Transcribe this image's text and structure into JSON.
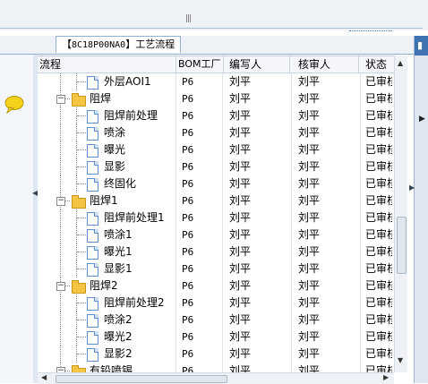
{
  "tab": {
    "prefix": "【",
    "code": "8C18P00NA0",
    "suffix": "】",
    "title": "工艺流程"
  },
  "columns": {
    "flow": "流程",
    "bom": "BOM工厂",
    "editor": "编写人",
    "reviewer": "核审人",
    "status": "状态"
  },
  "rows": [
    {
      "name": "外层AOI1",
      "level": 2,
      "type": "doc",
      "bom": "P6",
      "editor": "刘平",
      "reviewer": "刘平",
      "status": "已审核"
    },
    {
      "name": "阻焊",
      "level": 1,
      "type": "folder",
      "bom": "P6",
      "editor": "刘平",
      "reviewer": "刘平",
      "status": "已审核"
    },
    {
      "name": "阻焊前处理",
      "level": 2,
      "type": "doc",
      "bom": "P6",
      "editor": "刘平",
      "reviewer": "刘平",
      "status": "已审核"
    },
    {
      "name": "喷涂",
      "level": 2,
      "type": "doc",
      "bom": "P6",
      "editor": "刘平",
      "reviewer": "刘平",
      "status": "已审核"
    },
    {
      "name": "曝光",
      "level": 2,
      "type": "doc",
      "bom": "P6",
      "editor": "刘平",
      "reviewer": "刘平",
      "status": "已审核"
    },
    {
      "name": "显影",
      "level": 2,
      "type": "doc",
      "bom": "P6",
      "editor": "刘平",
      "reviewer": "刘平",
      "status": "已审核"
    },
    {
      "name": "终固化",
      "level": 2,
      "type": "doc",
      "bom": "P6",
      "editor": "刘平",
      "reviewer": "刘平",
      "status": "已审核"
    },
    {
      "name": "阻焊1",
      "level": 1,
      "type": "folder",
      "bom": "P6",
      "editor": "刘平",
      "reviewer": "刘平",
      "status": "已审核"
    },
    {
      "name": "阻焊前处理1",
      "level": 2,
      "type": "doc",
      "bom": "P6",
      "editor": "刘平",
      "reviewer": "刘平",
      "status": "已审核"
    },
    {
      "name": "喷涂1",
      "level": 2,
      "type": "doc",
      "bom": "P6",
      "editor": "刘平",
      "reviewer": "刘平",
      "status": "已审核"
    },
    {
      "name": "曝光1",
      "level": 2,
      "type": "doc",
      "bom": "P6",
      "editor": "刘平",
      "reviewer": "刘平",
      "status": "已审核"
    },
    {
      "name": "显影1",
      "level": 2,
      "type": "doc",
      "bom": "P6",
      "editor": "刘平",
      "reviewer": "刘平",
      "status": "已审核"
    },
    {
      "name": "阻焊2",
      "level": 1,
      "type": "folder",
      "bom": "P6",
      "editor": "刘平",
      "reviewer": "刘平",
      "status": "已审核"
    },
    {
      "name": "阻焊前处理2",
      "level": 2,
      "type": "doc",
      "bom": "P6",
      "editor": "刘平",
      "reviewer": "刘平",
      "status": "已审核"
    },
    {
      "name": "喷涂2",
      "level": 2,
      "type": "doc",
      "bom": "P6",
      "editor": "刘平",
      "reviewer": "刘平",
      "status": "已审核"
    },
    {
      "name": "曝光2",
      "level": 2,
      "type": "doc",
      "bom": "P6",
      "editor": "刘平",
      "reviewer": "刘平",
      "status": "已审核"
    },
    {
      "name": "显影2",
      "level": 2,
      "type": "doc",
      "bom": "P6",
      "editor": "刘平",
      "reviewer": "刘平",
      "status": "已审核"
    },
    {
      "name": "有铅喷锡",
      "level": 1,
      "type": "folder",
      "bom": "P6",
      "editor": "刘平",
      "reviewer": "刘平",
      "status": "已审核"
    }
  ],
  "colors": {
    "accent": "#3f72b0",
    "folder": "#f4c542",
    "doc_border": "#5b8fd1",
    "bubble": "#f2d21b"
  },
  "icons": {
    "chat": "speech-bubble-icon",
    "folder": "folder-icon",
    "doc": "document-icon"
  }
}
